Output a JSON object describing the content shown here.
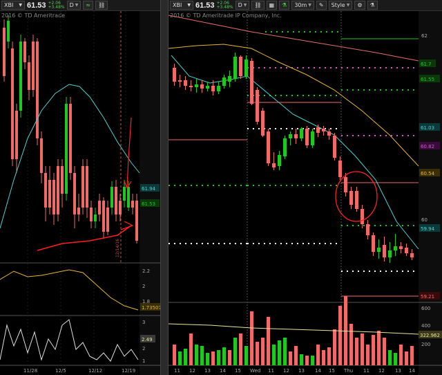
{
  "left": {
    "toolbar": {
      "symbol": "XBI",
      "price": "61.53",
      "change_abs": "+2.06",
      "change_pct": "+3.48%",
      "btn_d": "D",
      "btn_chart": "≈"
    },
    "watermark": "2016 © TD Ameritrade",
    "price_labels": {
      "upper": "61.94",
      "current": "61.53"
    },
    "osc1_ticks": [
      "2.2",
      "2",
      "1.8"
    ],
    "osc1_value": "1.73507",
    "osc2_ticks": [
      "3",
      "2",
      "1"
    ],
    "osc2_value": "2.49",
    "x_ticks": [
      "11/28",
      "12/5",
      "12/12",
      "12/19"
    ],
    "annotation": "12/14/16"
  },
  "right": {
    "toolbar": {
      "symbol": "XBI",
      "price": "61.53",
      "change_abs": "+2.06",
      "change_pct": "+3.48%",
      "btn_d": "D",
      "interval": "30m",
      "style": "Style"
    },
    "watermark": "2016 © TD Ameritrade IP Company, Inc.",
    "price_ticks": [
      "62",
      "60"
    ],
    "price_labels": {
      "p1": "61.7",
      "p2": "61.55",
      "p3": "61.03",
      "p4": "60.82",
      "p5": "60.54",
      "p6": "59.94",
      "p7": "59.21"
    },
    "volume_ticks": [
      "600",
      "400",
      "200"
    ],
    "volume_value": "322.962",
    "x_ticks": [
      "11",
      "12",
      "13",
      "14",
      "15",
      "Wed",
      "11",
      "12",
      "13",
      "14",
      "15",
      "Thu",
      "11",
      "12",
      "13",
      "14"
    ]
  },
  "colors": {
    "up": "#1ec81e",
    "down": "#f06a6a",
    "ema": "#4ad3d3",
    "sma_slow": "#e56d6d",
    "sma_mid": "#e6b43a",
    "background": "#000000"
  }
}
